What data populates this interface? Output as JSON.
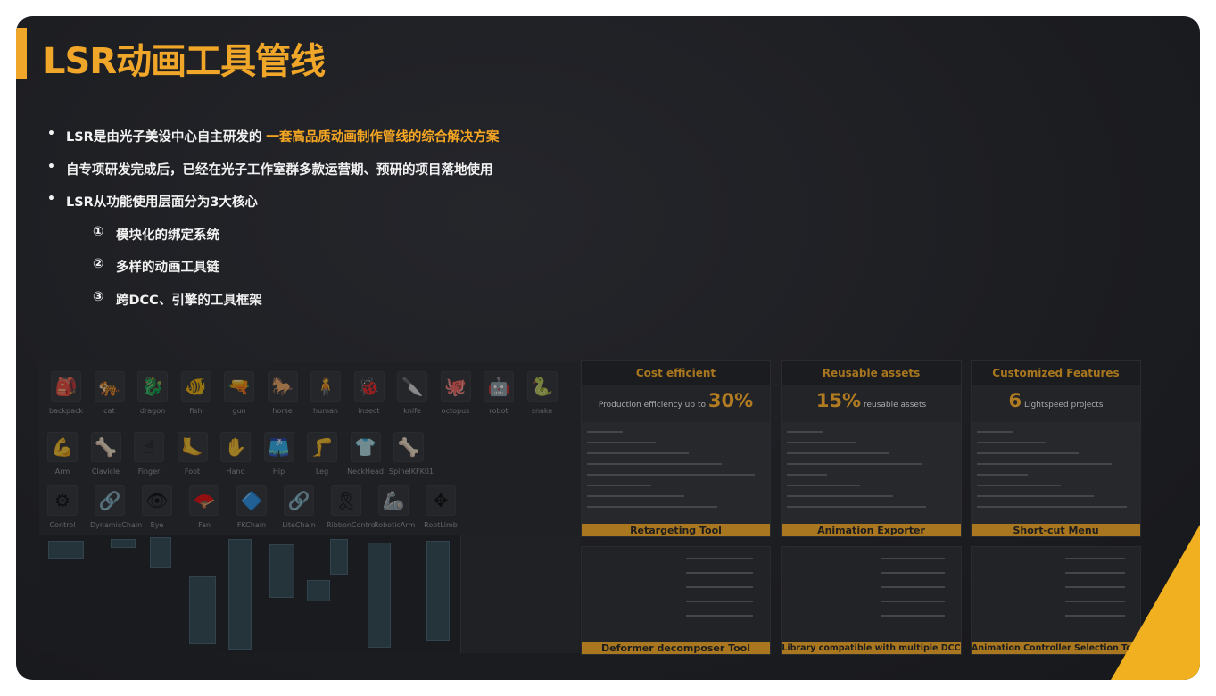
{
  "slide": {
    "title": "LSR动画工具管线",
    "bullets": [
      {
        "text": "LSR是由光子美设中心自主研发的",
        "highlight": "一套高品质动画制作管线的综合解决方案"
      },
      {
        "text": "自专项研发完成后，已经在光子工作室群多款运营期、预研的项目落地使用",
        "highlight": ""
      },
      {
        "text": "LSR从功能使用层面分为3大核心",
        "highlight": ""
      }
    ],
    "sub_items": [
      {
        "num": "①",
        "text": "模块化的绑定系统"
      },
      {
        "num": "②",
        "text": "多样的动画工具链"
      },
      {
        "num": "③",
        "text": "跨DCC、引擎的工具框架"
      }
    ]
  },
  "tools": {
    "row1": [
      "backpack",
      "cat",
      "dragon",
      "fish",
      "gun",
      "horse",
      "human",
      "insect",
      "knife",
      "octopus",
      "robot",
      "snake"
    ],
    "row1_icons": [
      "🎒",
      "🐅",
      "🐉",
      "🐠",
      "🔫",
      "🐎",
      "🧍",
      "🐞",
      "🔪",
      "🐙",
      "🤖",
      "🐍"
    ],
    "row2": [
      "Arm",
      "Clavicle",
      "Finger",
      "Foot",
      "Hand",
      "Hip",
      "Leg",
      "NeckHead",
      "SpineIKFK01"
    ],
    "row2_icons": [
      "💪",
      "🦴",
      "☝",
      "🦶",
      "✋",
      "🩳",
      "🦵",
      "👕",
      "🦴"
    ],
    "row3": [
      "Control",
      "DynamicChain",
      "Eye",
      "Fan",
      "FKChain",
      "LiteChain",
      "RibbonControl",
      "RoboticArm",
      "RootLimb"
    ],
    "row3_icons": [
      "⚙",
      "🔗",
      "👁",
      "🪭",
      "🔷",
      "🔗",
      "🎗",
      "🦾",
      "✥"
    ]
  },
  "panels": [
    {
      "head": "Cost efficient",
      "stat_text": "Production efficiency up to",
      "stat_big": "30%",
      "caption": "Retargeting Tool",
      "caption2": "Deformer decomposer Tool"
    },
    {
      "head": "Reusable assets",
      "stat_text": "reusable assets",
      "stat_big": "15%",
      "caption": "Animation Exporter",
      "caption2": "Library compatible with multiple DCC"
    },
    {
      "head": "Customized Features",
      "stat_text": "Lightspeed projects",
      "stat_big": "6",
      "caption": "Short-cut Menu",
      "caption2": "Animation Controller Selection Tool"
    }
  ],
  "colors": {
    "accent": "#f0a628",
    "background": "#1c1d21",
    "corner": "#f0b020"
  }
}
